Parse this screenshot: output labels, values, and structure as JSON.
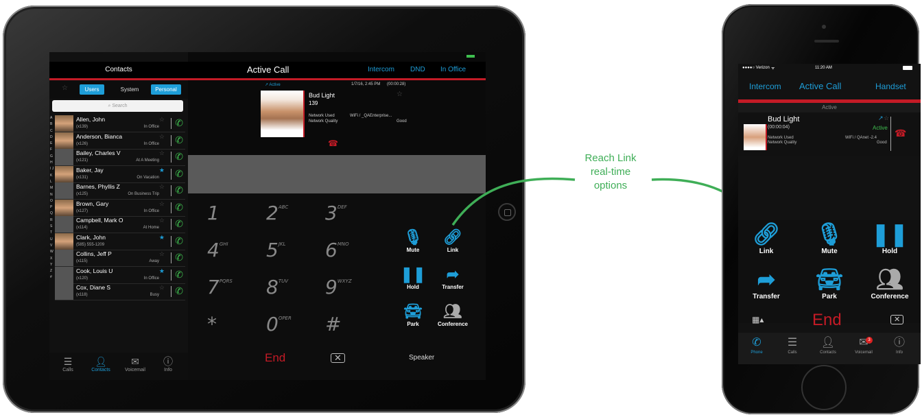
{
  "annotation": {
    "line1": "Reach Link",
    "line2": "real-time",
    "line3": "options",
    "color": "#3fae57"
  },
  "ipad": {
    "contacts_title": "Contacts",
    "filters": [
      "Users",
      "System",
      "Personal"
    ],
    "search_placeholder": "Search",
    "alphabet": "A B C D E F G H I J K L M N O P Q R S T U V W X Y Z #",
    "contacts": [
      {
        "name": "Allen, John",
        "ext": "(x139)",
        "status": "In Office",
        "fav": false,
        "photo": true
      },
      {
        "name": "Anderson, Bianca",
        "ext": "(x126)",
        "status": "In Office",
        "fav": false,
        "photo": true
      },
      {
        "name": "Bailey, Charles V",
        "ext": "(x121)",
        "status": "At A Meeting",
        "fav": false,
        "photo": false
      },
      {
        "name": "Baker, Jay",
        "ext": "(x131)",
        "status": "On Vacation",
        "fav": true,
        "photo": true
      },
      {
        "name": "Barnes, Phyllis Z",
        "ext": "(x125)",
        "status": "On Business Trip",
        "fav": false,
        "photo": false
      },
      {
        "name": "Brown, Gary",
        "ext": "(x127)",
        "status": "In Office",
        "fav": false,
        "photo": true
      },
      {
        "name": "Campbell, Mark O",
        "ext": "(x114)",
        "status": "At Home",
        "fav": false,
        "photo": false
      },
      {
        "name": "Clark, John",
        "ext": "(585) 555-1209",
        "status": "",
        "fav": true,
        "photo": true
      },
      {
        "name": "Collins, Jeff P",
        "ext": "(x115)",
        "status": "Away",
        "fav": false,
        "photo": false
      },
      {
        "name": "Cook, Louis U",
        "ext": "(x120)",
        "status": "In Office",
        "fav": true,
        "photo": false
      },
      {
        "name": "Cox, Diane S",
        "ext": "(x118)",
        "status": "Busy",
        "fav": false,
        "photo": false
      }
    ],
    "tabs": [
      "Calls",
      "Contacts",
      "Voicemail",
      "Info"
    ],
    "active_call_title": "Active Call",
    "header_links": [
      "Intercom",
      "DND",
      "In Office"
    ],
    "call_status": "Active",
    "call_datetime": "1/7/16, 2:45 PM",
    "call_duration": "(00:00:28)",
    "caller_name": "Bud Light",
    "caller_ext": "139",
    "network_used_label": "Network Used",
    "network_used_value": "WiFi / _QAEnterprise...",
    "network_quality_label": "Network Quality",
    "network_quality_value": "Good",
    "keys": [
      {
        "d": "1",
        "l": ""
      },
      {
        "d": "2",
        "l": "ABC"
      },
      {
        "d": "3",
        "l": "DEF"
      },
      {
        "d": "4",
        "l": "GHI"
      },
      {
        "d": "5",
        "l": "JKL"
      },
      {
        "d": "6",
        "l": "MNO"
      },
      {
        "d": "7",
        "l": "PQRS"
      },
      {
        "d": "8",
        "l": "TUV"
      },
      {
        "d": "9",
        "l": "WXYZ"
      },
      {
        "d": "*",
        "l": ""
      },
      {
        "d": "0",
        "l": "OPER"
      },
      {
        "d": "#",
        "l": ""
      }
    ],
    "end_label": "End",
    "options": [
      "Mute",
      "Link",
      "Hold",
      "Transfer",
      "Park",
      "Conference"
    ],
    "speaker_label": "Speaker"
  },
  "iphone": {
    "carrier": "●●●●○ Verizon",
    "time": "11:20 AM",
    "header_left": "Intercom",
    "header_title": "Active Call",
    "header_right": "Handset",
    "active_label": "Active",
    "caller_name": "Bud Light",
    "call_duration": "(00:00:04)",
    "call_status": "Active",
    "network_used_label": "Network Used",
    "network_used_value": "WiFi / QAnet -2.4",
    "network_quality_label": "Network Quality",
    "network_quality_value": "Good",
    "options": [
      "Link",
      "Mute",
      "Hold",
      "Transfer",
      "Park",
      "Conference"
    ],
    "end_label": "End",
    "tabs": [
      "Phone",
      "Calls",
      "Contacts",
      "Voicemail",
      "Info"
    ],
    "voicemail_badge": "3"
  }
}
